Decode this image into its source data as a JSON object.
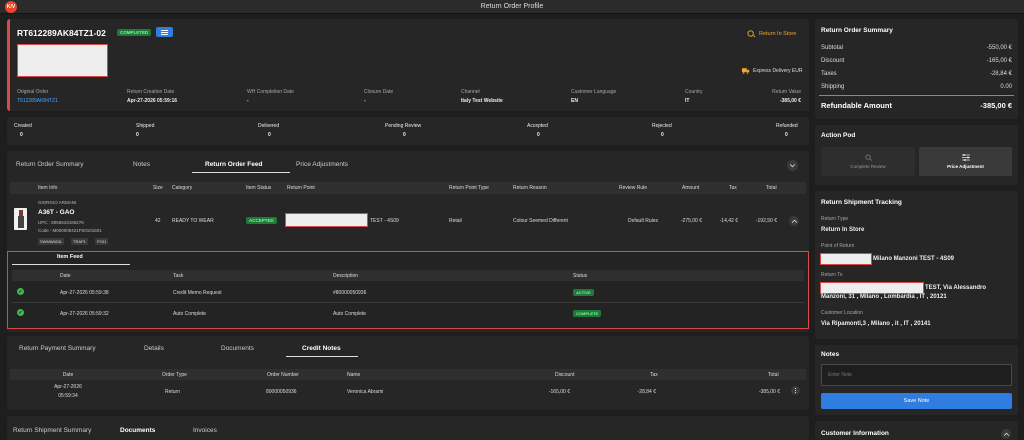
{
  "app": {
    "logo": "K/V",
    "title": "Return Order Profile"
  },
  "order": {
    "id": "RT612289AK84TZ1-02",
    "status": "COMPLETED",
    "store_label": "Return In Store",
    "delivery_label": "Express Delivery EUR",
    "fields": [
      {
        "label": "Original Order",
        "value": "T612289AK84TZ1"
      },
      {
        "label": "Return Creation Date",
        "value": "Apr-27-2026 05:59:16"
      },
      {
        "label": "WH Completion Date",
        "value": "-"
      },
      {
        "label": "Closure Date",
        "value": "-"
      },
      {
        "label": "Channel",
        "value": "Italy Test Website"
      },
      {
        "label": "Customer Language",
        "value": "EN"
      },
      {
        "label": "Country",
        "value": "IT"
      },
      {
        "label": "Return Value",
        "value": "-385,00 €"
      }
    ]
  },
  "counts": [
    {
      "label": "Created",
      "value": "0"
    },
    {
      "label": "Shipped",
      "value": "0"
    },
    {
      "label": "Delivered",
      "value": "0"
    },
    {
      "label": "Pending Review",
      "value": "0"
    },
    {
      "label": "Accepted",
      "value": "0"
    },
    {
      "label": "Rejected",
      "value": "0"
    },
    {
      "label": "Refunded",
      "value": "0"
    }
  ],
  "tabs1": [
    "Return Order Summary",
    "Notes",
    "Return Order Feed",
    "Price Adjustments"
  ],
  "items_table": {
    "headers": [
      "Item Info",
      "Size",
      "Category",
      "Item Status",
      "Return Point",
      "Return Point Type",
      "Return Reason",
      "Review Rule",
      "Amount",
      "Tax",
      "Total"
    ],
    "brand": "GIORGIO ARMANI",
    "name": "A36T - GAO",
    "upc": "UPC : 8056643186276",
    "code": "Code : M000009421P20101501",
    "tags": [
      "SWMWADIL",
      "TRAP1",
      "P231"
    ],
    "size": "42",
    "category": "READY TO WEAR",
    "status": "ACCEPTED",
    "return_point": "TEST - 4S09",
    "return_point_type": "Retail",
    "reason": "Colour Seemed Different",
    "rule": "Default Rules",
    "amount": "-275,00 €",
    "tax": "-14,42 €",
    "total": "-192,50 €"
  },
  "item_feed": {
    "tab": "Item Feed",
    "headers": [
      "Date",
      "Task",
      "Description",
      "Status"
    ],
    "rows": [
      {
        "date": "Apr-27-2026 05:59:38",
        "task": "Credit Memo Request",
        "desc": "#80000050936",
        "status": "ACTIVE"
      },
      {
        "date": "Apr-27-2026 05:59:32",
        "task": "Auto Complete",
        "desc": "Auto Complete",
        "status": "COMPLETE"
      }
    ]
  },
  "tabs2": [
    "Return Payment Summary",
    "Details",
    "Documents",
    "Credit Notes"
  ],
  "credit_table": {
    "headers": [
      "Date",
      "Order Type",
      "Order Number",
      "Name",
      "Discount",
      "Tax",
      "Total"
    ],
    "row": {
      "date1": "Apr-27-2026",
      "date2": "05:59:34",
      "type": "Return",
      "number": "80000050936",
      "name": "Veronica Abrami",
      "discount": "-165,00 €",
      "tax": "-28,84 €",
      "total": "-385,00 €"
    }
  },
  "tabs3": [
    "Return Shipment Summary",
    "Documents",
    "Invoices"
  ],
  "summary": {
    "title": "Return Order Summary",
    "rows": [
      {
        "label": "Subtotal",
        "value": "-550,00 €"
      },
      {
        "label": "Discount",
        "value": "-165,00 €"
      },
      {
        "label": "Taxes",
        "value": "-28,84 €"
      },
      {
        "label": "Shipping",
        "value": "0.00"
      }
    ],
    "refund_label": "Refundable Amount",
    "refund_value": "-385,00 €"
  },
  "action_pod": {
    "title": "Action Pod",
    "complete": "Complete Review",
    "price": "Price Adjustment"
  },
  "tracking": {
    "title": "Return Shipment Tracking",
    "type_label": "Return Type",
    "type_value": "Return In Store",
    "point_label": "Point of Return",
    "point_value": "Milano Manzoni TEST - 4S09",
    "to_label": "Return To",
    "to_value1": "TEST, Via Alessandro",
    "to_value2": "Manzoni, 31 , Milano , Lombardia , IT , 20121",
    "loc_label": "Customer Location",
    "loc_value": "Via Ripamonti,3 , Milano , it , IT , 20141"
  },
  "notes": {
    "title": "Notes",
    "placeholder": "Enter Note",
    "save": "Save Note"
  },
  "customer": {
    "title": "Customer Information"
  },
  "colors": {
    "accent": "#2f7de1",
    "danger": "#d84a4a",
    "success": "#3fb950",
    "warning": "#f0a830"
  }
}
